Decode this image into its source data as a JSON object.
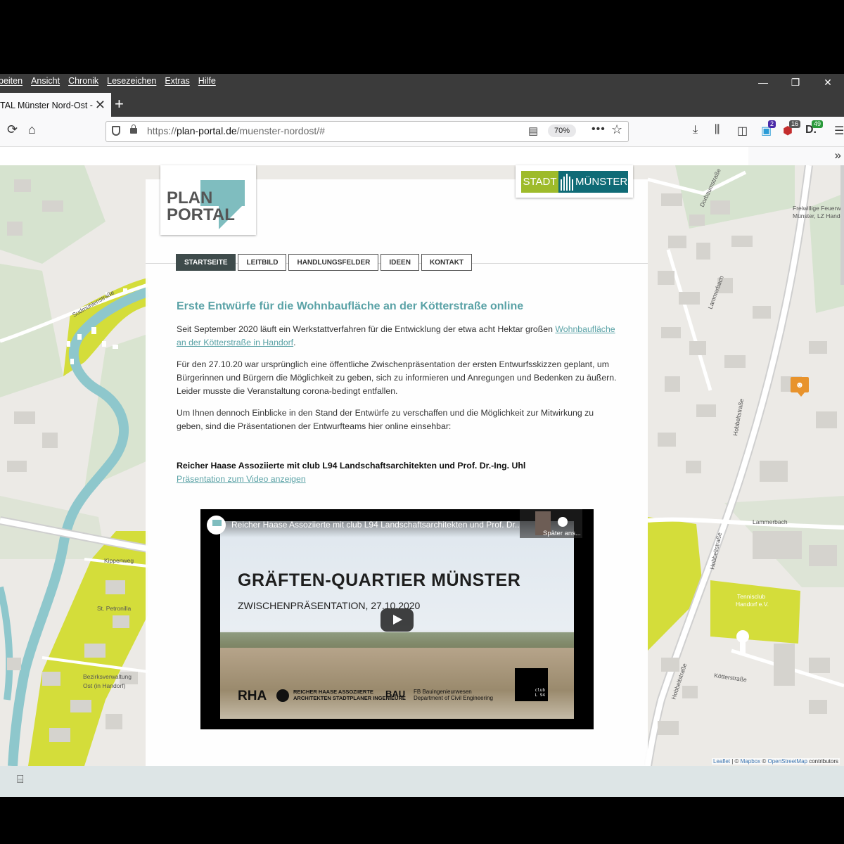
{
  "browser": {
    "menu": [
      "beiten",
      "Ansicht",
      "Chronik",
      "Lesezeichen",
      "Extras",
      "Hilfe"
    ],
    "tab_title": "TAL Münster Nord-Ost -",
    "url_scheme": "https://",
    "url_domain": "plan-portal.de",
    "url_path": "/muenster-nordost/#",
    "zoom": "70%",
    "badges": {
      "b1": "2",
      "b2": "16",
      "b3": "49"
    },
    "badge_colors": {
      "b1": "#4a2aa8",
      "b2": "#c42d2d",
      "b3": "#2a9a3a"
    }
  },
  "site": {
    "logo_line1": "PLAN",
    "logo_line2": "PORTAL",
    "stadt_left": "STADT",
    "stadt_right": "MÜNSTER",
    "nav": [
      "STARTSEITE",
      "LEITBILD",
      "HANDLUNGSFELDER",
      "IDEEN",
      "KONTAKT"
    ]
  },
  "article": {
    "title": "Erste Entwürfe für die Wohnbaufläche an der Kötterstraße online",
    "p1_text": "Seit September 2020 läuft ein Werkstattverfahren für die Entwicklung der etwa acht Hektar großen ",
    "p1_link": "Wohnbaufläche an der Kötterstraße in Handorf",
    "p1_end": ".",
    "p2": "Für den 27.10.20 war ursprünglich eine öffentliche Zwischenpräsentation der ersten Entwurfsskizzen geplant, um Bürgerinnen und Bürgern die Möglichkeit zu geben, sich zu informieren und Anregungen und Bedenken zu äußern. Leider musste die Veranstaltung corona-bedingt entfallen.",
    "p3": "Um Ihnen dennoch Einblicke in den Stand der Entwürfe zu verschaffen und die Möglichkeit zur Mitwirkung zu geben, sind die Präsentationen der Entwurfteams hier online einsehbar:",
    "team": "Reicher Haase Assoziierte mit club L94 Landschaftsarchitekten und Prof. Dr.-Ing. Uhl",
    "video_link": "Präsentation zum Video anzeigen"
  },
  "video": {
    "title": "Reicher Haase Assoziierte mit club L94 Landschaftsarchitekten und Prof. Dr....",
    "later": "Später ans...",
    "slide_title": "GRÄFTEN-QUARTIER MÜNSTER",
    "slide_subtitle": "ZWISCHENPRÄSENTATION, 27.10.2020",
    "rha": "RHA",
    "rha_line1": "REICHER HAASE ASSOZIIERTE",
    "rha_line2": "ARCHITEKTEN  STADTPLANER  INGENIEURE",
    "bau": "BAU",
    "bau_line1": "FB Bauingenieurwesen",
    "bau_line2": "Department of Civil Engineering",
    "club_line1": "club",
    "club_line2": "L 94"
  },
  "map": {
    "streets": {
      "s1": "Sudmühlenstraße",
      "s2": "Dorbaumstraße",
      "s3": "Lammerbach",
      "s4": "Hobbeltstraße",
      "s5": "Hobbeltstraße",
      "s6": "Hobbeltstraße",
      "s7": "Lammerbach",
      "s8": "Kippenweg",
      "s9": "St. Petronilla",
      "s10": "Bezirksverwaltung",
      "s11": "Ost (in Handorf)",
      "s12": "Kötterstraße",
      "s13": "Tennisclub",
      "s14": "Handorf e.V.",
      "s15": "Freiwillige Feuerwe",
      "s16": "Münster, LZ Hando"
    },
    "attr_leaflet": "Leaflet",
    "attr_sep1": " | © ",
    "attr_mapbox": "Mapbox",
    "attr_sep2": " © ",
    "attr_osm": "OpenStreetMap",
    "attr_end": " contributors"
  }
}
